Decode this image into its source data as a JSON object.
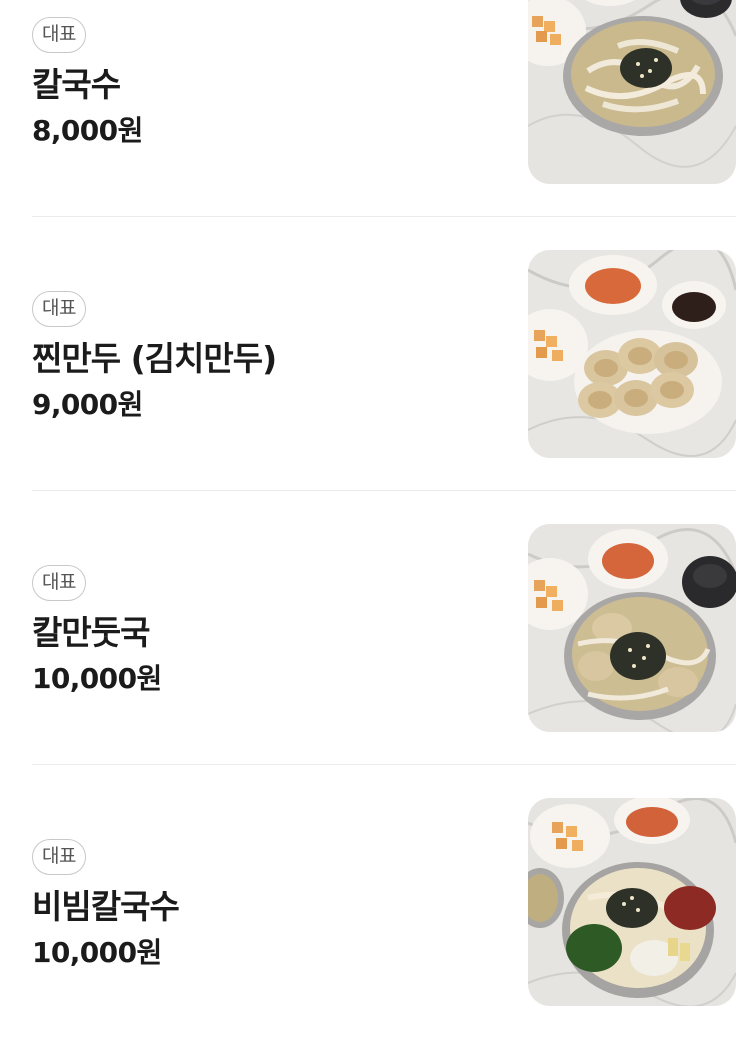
{
  "menu": {
    "items": [
      {
        "badge": "대표",
        "name": "칼국수",
        "price": "8,000원",
        "photo": "kalguksu-photo"
      },
      {
        "badge": "대표",
        "name": "찐만두 (김치만두)",
        "price": "9,000원",
        "photo": "steamed-dumplings-photo"
      },
      {
        "badge": "대표",
        "name": "칼만둣국",
        "price": "10,000원",
        "photo": "kal-mandu-guk-photo"
      },
      {
        "badge": "대표",
        "name": "비빔칼국수",
        "price": "10,000원",
        "photo": "bibim-kalguksu-photo"
      }
    ]
  },
  "colors": {
    "text": "#1b1b1b",
    "badge_border": "#c8c8c8",
    "badge_text": "#555555",
    "divider": "#ececec"
  }
}
